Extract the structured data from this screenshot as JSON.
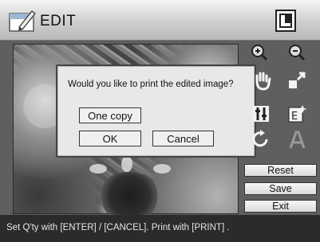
{
  "header": {
    "title": "EDIT",
    "left_icon": "edit-pencil-icon",
    "right_icon": "layout-mode-icon"
  },
  "dialog": {
    "message": "Would you like to print the edited image?",
    "copy_label": "One copy",
    "ok_label": "OK",
    "cancel_label": "Cancel"
  },
  "tools": [
    "zoom-in-icon",
    "zoom-out-icon",
    "hand-move-icon",
    "resize-icon",
    "adjust-icon",
    "effect-icon",
    "rotate-icon",
    "text-icon"
  ],
  "side_buttons": {
    "reset": "Reset",
    "save": "Save",
    "exit": "Exit"
  },
  "status": {
    "text": "Set Q'ty with [ENTER] / [CANCEL].  Print with  [PRINT] ."
  }
}
